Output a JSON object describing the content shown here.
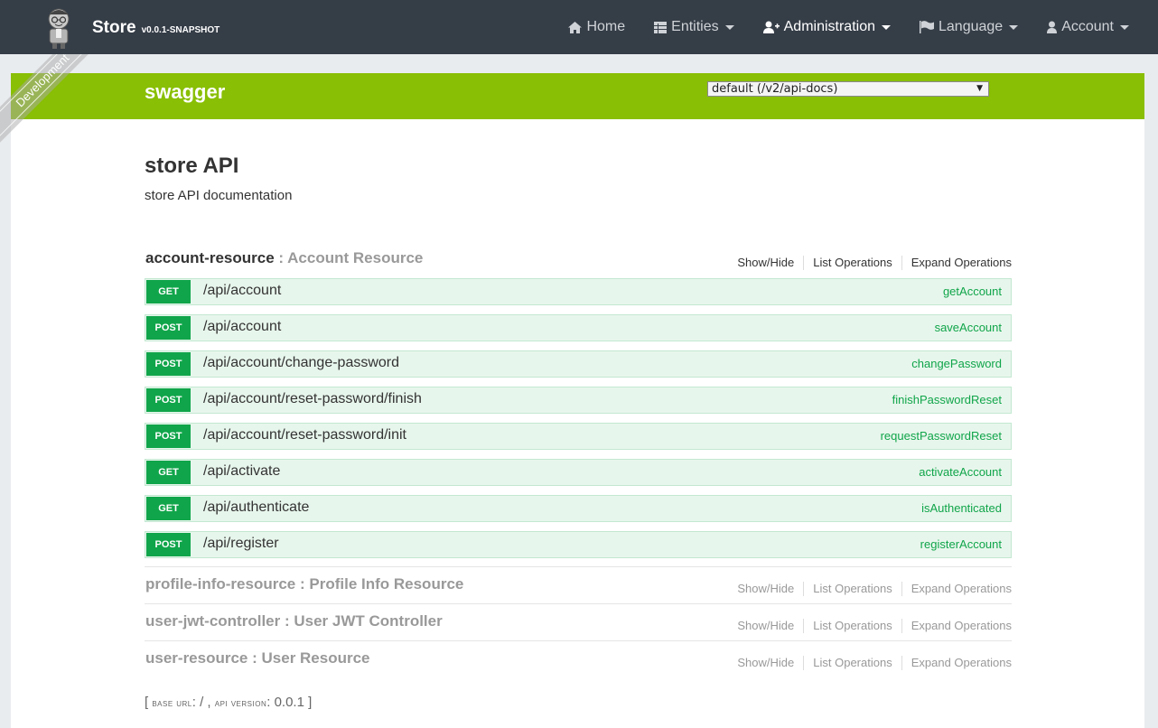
{
  "navbar": {
    "brand": "Store",
    "version": "v0.0.1-SNAPSHOT",
    "items": [
      {
        "label": "Home",
        "icon": "home-icon",
        "dropdown": false
      },
      {
        "label": "Entities",
        "icon": "table-icon",
        "dropdown": true
      },
      {
        "label": "Administration",
        "icon": "user-plus-icon",
        "dropdown": true
      },
      {
        "label": "Language",
        "icon": "flag-icon",
        "dropdown": true
      },
      {
        "label": "Account",
        "icon": "user-icon",
        "dropdown": true
      }
    ]
  },
  "ribbon": "Development",
  "swagger": {
    "title": "swagger",
    "spec_selected": "default (/v2/api-docs)"
  },
  "api": {
    "title": "store API",
    "description": "store API documentation"
  },
  "resource_ops": {
    "show_hide": "Show/Hide",
    "list": "List Operations",
    "expand": "Expand Operations"
  },
  "resources": [
    {
      "name": "account-resource",
      "description": ": Account Resource",
      "operations": [
        {
          "method": "GET",
          "path": "/api/account",
          "nickname": "getAccount"
        },
        {
          "method": "POST",
          "path": "/api/account",
          "nickname": "saveAccount"
        },
        {
          "method": "POST",
          "path": "/api/account/change-password",
          "nickname": "changePassword"
        },
        {
          "method": "POST",
          "path": "/api/account/reset-password/finish",
          "nickname": "finishPasswordReset"
        },
        {
          "method": "POST",
          "path": "/api/account/reset-password/init",
          "nickname": "requestPasswordReset"
        },
        {
          "method": "GET",
          "path": "/api/activate",
          "nickname": "activateAccount"
        },
        {
          "method": "GET",
          "path": "/api/authenticate",
          "nickname": "isAuthenticated"
        },
        {
          "method": "POST",
          "path": "/api/register",
          "nickname": "registerAccount"
        }
      ]
    },
    {
      "name": "profile-info-resource",
      "description": ": Profile Info Resource"
    },
    {
      "name": "user-jwt-controller",
      "description": ": User JWT Controller"
    },
    {
      "name": "user-resource",
      "description": ": User Resource"
    }
  ],
  "footer": {
    "open": "[",
    "base_url_label": "base url",
    "base_url_value": ": / ,",
    "api_version_label": "api version",
    "api_version_value": ": 0.0.1",
    "close": "]"
  }
}
